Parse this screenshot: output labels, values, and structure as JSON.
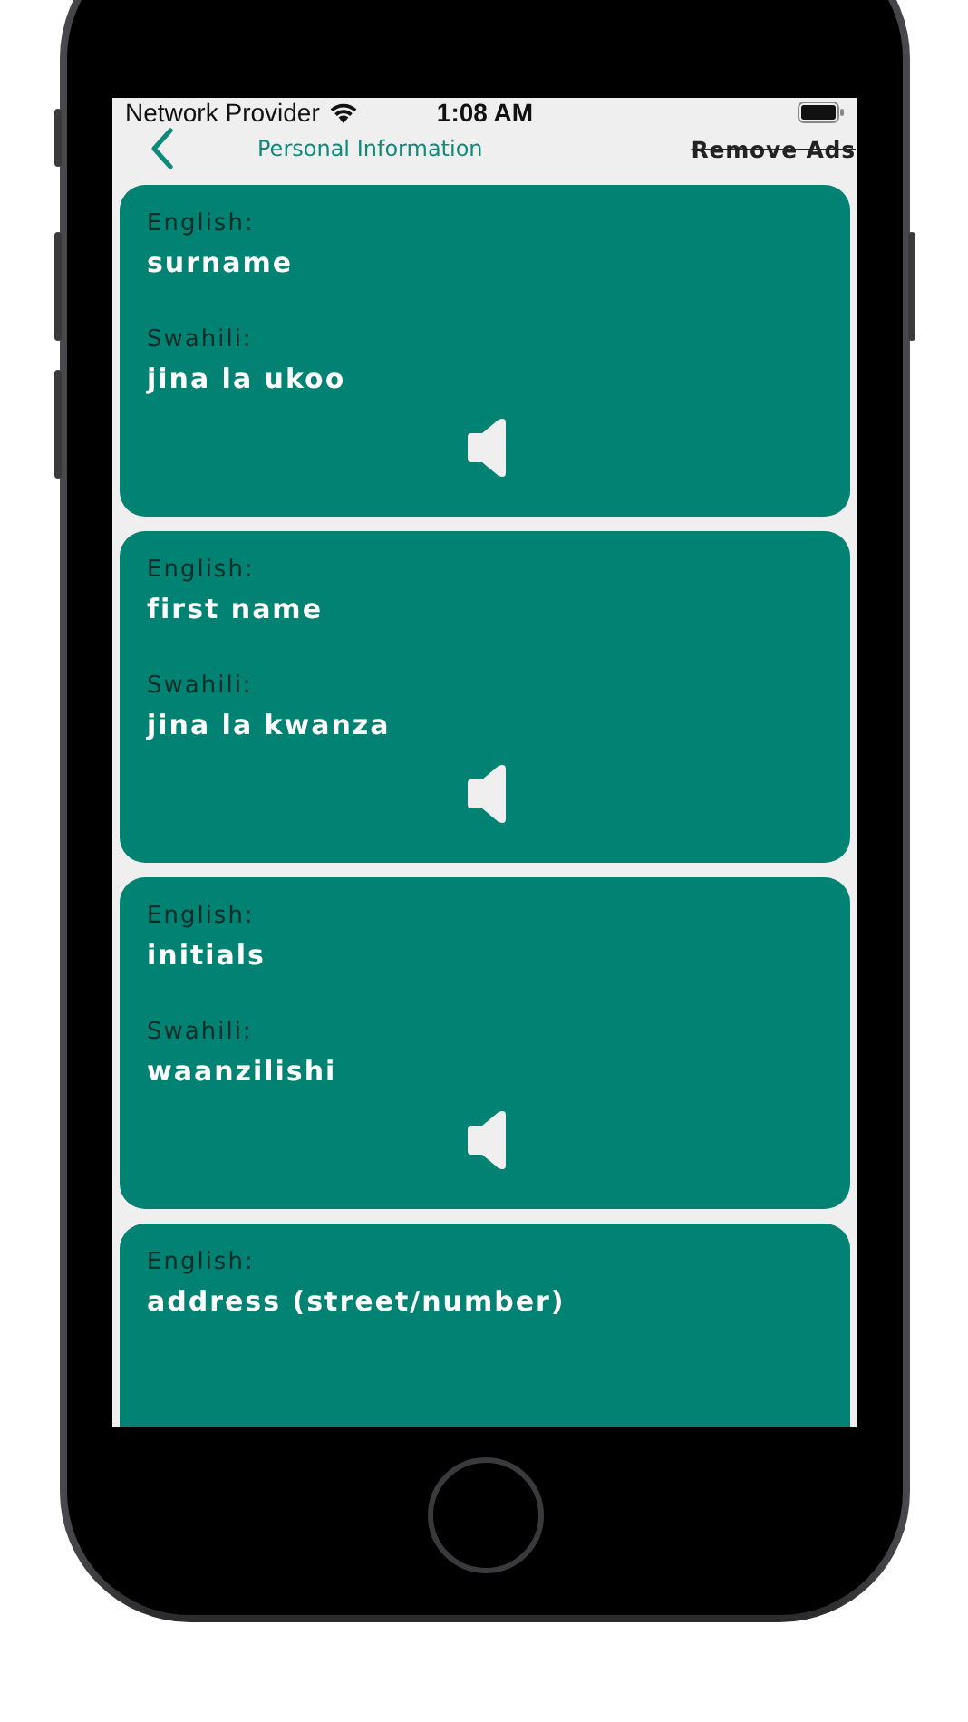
{
  "status_bar": {
    "carrier": "Network Provider",
    "time": "1:08 AM"
  },
  "header": {
    "title": "Personal Information",
    "remove_ads": "Remove Ads"
  },
  "cards": [
    {
      "english_label": "English:",
      "english": "surname",
      "swahili_label": "Swahili:",
      "swahili": "jina la ukoo"
    },
    {
      "english_label": "English:",
      "english": "first name",
      "swahili_label": "Swahili:",
      "swahili": "jina la kwanza"
    },
    {
      "english_label": "English:",
      "english": "initials",
      "swahili_label": "Swahili:",
      "swahili": "waanzilishi"
    },
    {
      "english_label": "English:",
      "english": "address (street/number)"
    }
  ]
}
